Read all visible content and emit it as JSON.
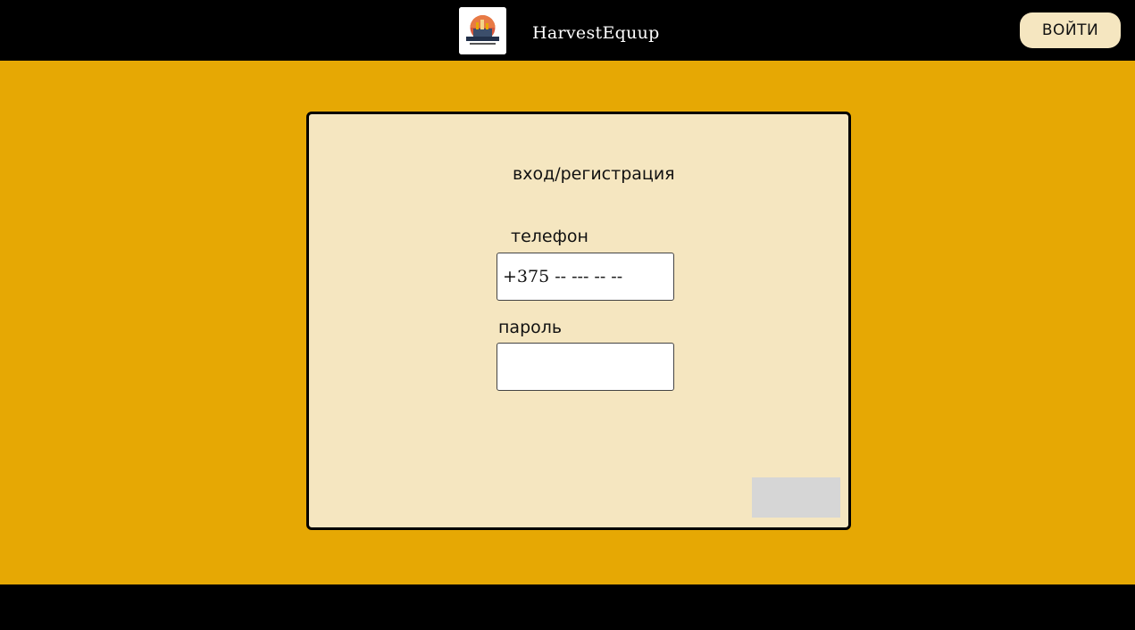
{
  "header": {
    "brand_name": "HarvestEquup",
    "login_label": "ВОЙТИ",
    "logo_icon": "harvest-logo-icon"
  },
  "form": {
    "title": "вход/регистрация",
    "phone_label": "телефон",
    "phone_placeholder": "+375 -- --- -- --",
    "password_label": "пароль",
    "password_value": ""
  },
  "colors": {
    "background": "#e6a804",
    "header": "#000000",
    "panel": "#f5e6c0",
    "login_button": "#f5e6c0",
    "submit_button": "#d6d6d6"
  }
}
